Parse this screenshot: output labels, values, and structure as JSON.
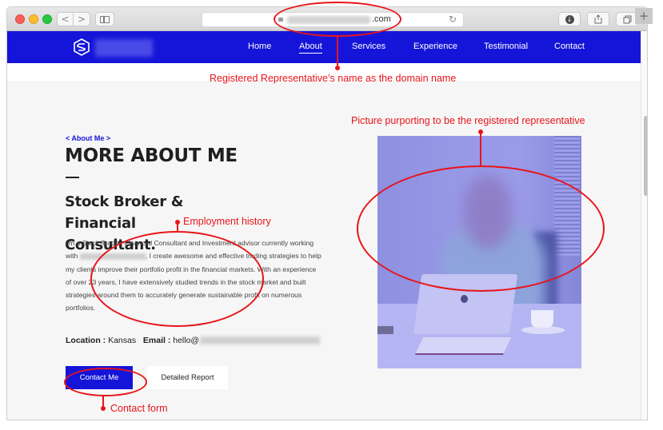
{
  "browser": {
    "url_visible_suffix": ".com",
    "buttons": {
      "back": "<",
      "forward": ">",
      "reload": "↻",
      "new_tab": "+"
    }
  },
  "site": {
    "nav": [
      {
        "label": "Home",
        "active": false
      },
      {
        "label": "About",
        "active": true
      },
      {
        "label": "Services",
        "active": false
      },
      {
        "label": "Experience",
        "active": false
      },
      {
        "label": "Testimonial",
        "active": false
      },
      {
        "label": "Contact",
        "active": false
      }
    ],
    "brand_color": "#1515d9"
  },
  "about": {
    "eyebrow": "< About Me >",
    "title": "MORE ABOUT ME",
    "subtitle_line1": "Stock Broker & Financial",
    "subtitle_line2": "Consultant.",
    "bio_part1": "I'm a Stock Trader, Financial Consultant and Investment advisor currently working with",
    "bio_part2": ", I create awesome and effective trading strategies to help my clients improve their portfolio profit in the financial markets. With an experience of over 23 years, I have extensively studied trends in the stock market and built strategies around them to accurately generate sustainable profit on numerous portfolios.",
    "location_label": "Location :",
    "location_value": "Kansas",
    "email_label": "Email :",
    "email_visible": "hello@",
    "contact_button": "Contact Me",
    "report_button": "Detailed Report"
  },
  "annotations": {
    "domain": "Registered Representative’s name as the domain name",
    "picture": "Picture purporting to be the registered representative",
    "employment": "Employment history",
    "contact_form": "Contact form",
    "color": "#e8141a"
  }
}
